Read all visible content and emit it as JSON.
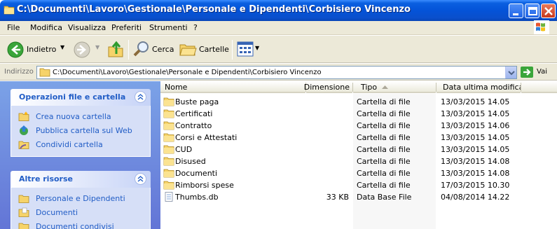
{
  "window": {
    "title": "C:\\Documenti\\Lavoro\\Gestionale\\Personale e Dipendenti\\Corbisiero Vincenzo"
  },
  "menu": {
    "items": [
      "File",
      "Modifica",
      "Visualizza",
      "Preferiti",
      "Strumenti",
      "?"
    ]
  },
  "toolbar": {
    "back_label": "Indietro",
    "search_label": "Cerca",
    "folders_label": "Cartelle"
  },
  "address": {
    "label": "Indirizzo",
    "value": "C:\\Documenti\\Lavoro\\Gestionale\\Personale e Dipendenti\\Corbisiero Vincenzo",
    "go_label": "Vai"
  },
  "taskpane": {
    "file_tasks": {
      "title": "Operazioni file e cartella",
      "items": [
        "Crea nuova cartella",
        "Pubblica cartella sul Web",
        "Condividi cartella"
      ]
    },
    "other_places": {
      "title": "Altre risorse",
      "items": [
        "Personale e Dipendenti",
        "Documenti",
        "Documenti condivisi"
      ]
    }
  },
  "filelist": {
    "columns": [
      "Nome",
      "Dimensione",
      "Tipo",
      "Data ultima modifica"
    ],
    "sorted_column": "Tipo",
    "rows": [
      {
        "name": "Buste paga",
        "size": "",
        "type": "Cartella di file",
        "modified": "13/03/2015 14.05",
        "icon": "folder-icon"
      },
      {
        "name": "Certificati",
        "size": "",
        "type": "Cartella di file",
        "modified": "13/03/2015 14.05",
        "icon": "folder-icon"
      },
      {
        "name": "Contratto",
        "size": "",
        "type": "Cartella di file",
        "modified": "13/03/2015 14.06",
        "icon": "folder-icon"
      },
      {
        "name": "Corsi e Attestati",
        "size": "",
        "type": "Cartella di file",
        "modified": "13/03/2015 14.05",
        "icon": "folder-icon"
      },
      {
        "name": "CUD",
        "size": "",
        "type": "Cartella di file",
        "modified": "13/03/2015 14.05",
        "icon": "folder-icon"
      },
      {
        "name": "Disused",
        "size": "",
        "type": "Cartella di file",
        "modified": "13/03/2015 14.08",
        "icon": "folder-icon"
      },
      {
        "name": "Documenti",
        "size": "",
        "type": "Cartella di file",
        "modified": "13/03/2015 14.08",
        "icon": "folder-icon"
      },
      {
        "name": "Rimborsi spese",
        "size": "",
        "type": "Cartella di file",
        "modified": "17/03/2015 10.30",
        "icon": "folder-icon"
      },
      {
        "name": "Thumbs.db",
        "size": "33 KB",
        "type": "Data Base File",
        "modified": "04/08/2014 14.22",
        "icon": "database-file-icon"
      }
    ]
  },
  "colors": {
    "titlebar": "#0453d8",
    "taskpane_link": "#215dc6",
    "chrome": "#ece9d8"
  }
}
